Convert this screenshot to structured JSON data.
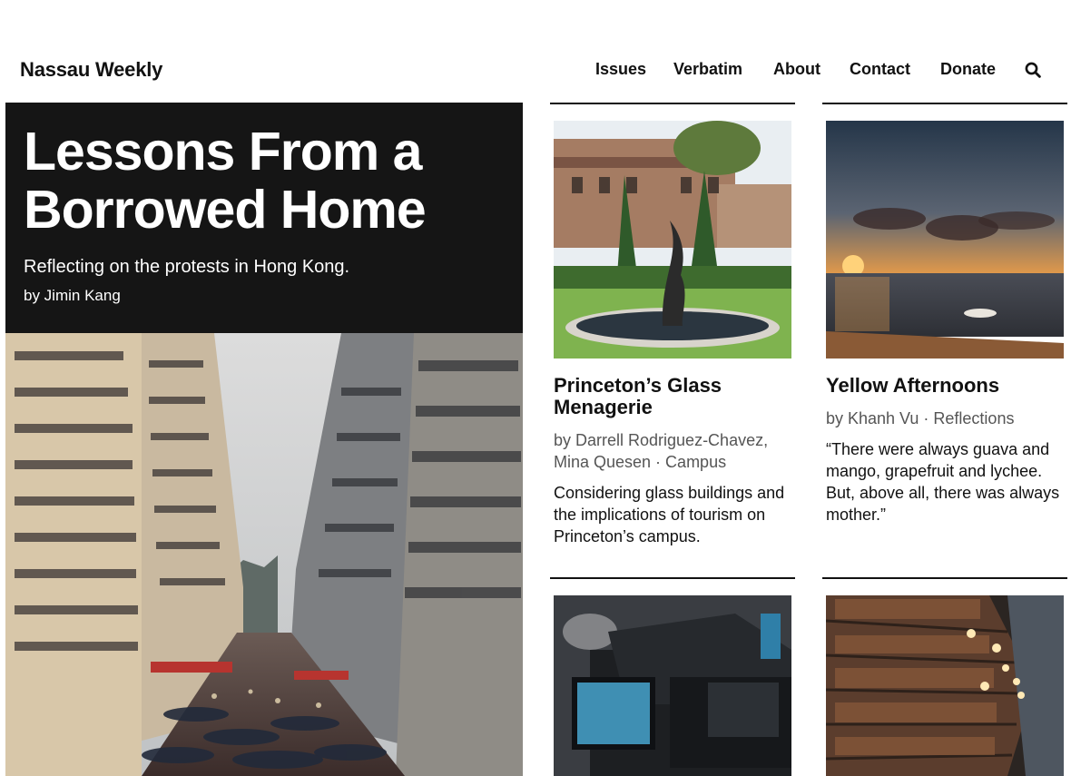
{
  "site": {
    "title": "Nassau Weekly"
  },
  "nav": {
    "items": [
      {
        "label": "Issues"
      },
      {
        "label": "Verbatim"
      },
      {
        "label": "About"
      },
      {
        "label": "Contact"
      },
      {
        "label": "Donate"
      }
    ],
    "search_icon": "search-icon"
  },
  "hero": {
    "title": "Lessons From a Borrowed Home",
    "dek": "Reflecting on the protests in Hong Kong.",
    "byline": "by Jimin Kang",
    "image": "hong-kong-street-photo"
  },
  "cards": [
    {
      "title": "Princeton’s Glass Menagerie",
      "meta": "by Darrell Rodriguez-Chavez, Mina Quesen · Campus",
      "dek": "Considering glass buildings and the implications of tourism on Princeton’s campus.",
      "image": "campus-fountain-photo"
    },
    {
      "title": "Yellow Afternoons",
      "meta": "by Khanh Vu · Reflections",
      "dek": "“There were always guava and mango, grapefruit and lychee. But, above all, there was always mother.”",
      "image": "sunset-beach-photo"
    },
    {
      "title": "",
      "meta": "",
      "dek": "",
      "image": "video-camera-photo"
    },
    {
      "title": "",
      "meta": "",
      "dek": "",
      "image": "library-bookshelves-photo"
    }
  ]
}
